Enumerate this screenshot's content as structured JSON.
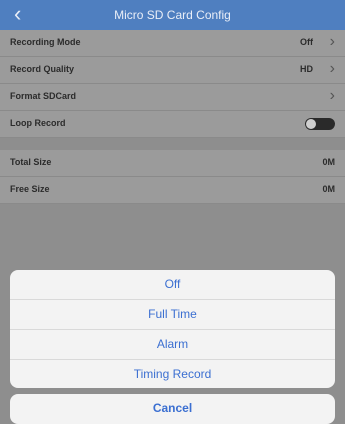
{
  "header": {
    "back_icon": "chevron-left-icon",
    "title": "Micro SD Card Config"
  },
  "settings": [
    {
      "label": "Recording Mode",
      "value": "Off"
    },
    {
      "label": "Record Quality",
      "value": "HD"
    },
    {
      "label": "Format SDCard",
      "value": ""
    },
    {
      "label": "Loop Record",
      "toggle_on": false
    }
  ],
  "storage": [
    {
      "label": "Total Size",
      "value": "0M"
    },
    {
      "label": "Free Size",
      "value": "0M"
    }
  ],
  "action_sheet": {
    "options": [
      "Off",
      "Full Time",
      "Alarm",
      "Timing Record"
    ],
    "cancel_label": "Cancel"
  },
  "colors": {
    "header": "#4f7fc0",
    "accent": "#3b6fd1"
  }
}
